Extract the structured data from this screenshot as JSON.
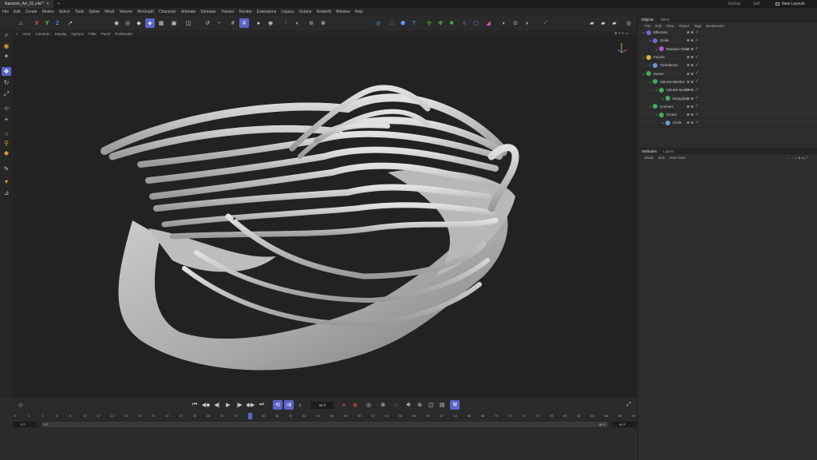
{
  "titlebar": {
    "doc_tab": "Random_Art_01.c4d *",
    "close": "×",
    "new_tab": "+",
    "right_items": [
      "Startup",
      "Sell",
      "New Layouts"
    ]
  },
  "menu": [
    "File",
    "Edit",
    "Create",
    "Modes",
    "Select",
    "Tools",
    "Spline",
    "Mesh",
    "Volume",
    "MoGraph",
    "Character",
    "Animate",
    "Simulate",
    "Tracker",
    "Render",
    "Extensions",
    "Legacy",
    "Octane",
    "Redshift",
    "Window",
    "Help"
  ],
  "axis_lock": {
    "x": "X",
    "y": "Y",
    "z": "Z"
  },
  "viewport_menu": [
    "View",
    "Cameras",
    "Display",
    "Options",
    "Filter",
    "Panel",
    "ProRender"
  ],
  "timeline": {
    "current_frame": "34 F",
    "ruler_ticks": [
      "0",
      "2",
      "4",
      "6",
      "8",
      "10",
      "12",
      "14",
      "16",
      "18",
      "20",
      "22",
      "24",
      "26",
      "28",
      "30",
      "32",
      "34",
      "36",
      "38",
      "40",
      "42",
      "44",
      "46",
      "48",
      "50",
      "52",
      "54",
      "56",
      "58",
      "60",
      "62",
      "64",
      "66",
      "68",
      "70",
      "72",
      "74",
      "76",
      "78",
      "80",
      "82",
      "84",
      "86",
      "88",
      "90"
    ],
    "start": "0 F",
    "range_start": "0 F",
    "range_end": "90 F",
    "end": "90 F",
    "playhead_label": "34",
    "playhead_fraction": 0.378
  },
  "objects_panel": {
    "tabs": [
      "Objects",
      "Takes"
    ],
    "menu": [
      "File",
      "Edit",
      "View",
      "Object",
      "Tags",
      "Bookmarks"
    ],
    "rows": [
      {
        "name": "Effectors",
        "indent": 0,
        "icon_color": "#6a6ad6"
      },
      {
        "name": "Scale",
        "indent": 1,
        "icon_color": "#6a6ad6"
      },
      {
        "name": "Random Field",
        "indent": 2,
        "icon_color": "#b05ad0"
      },
      {
        "name": "Forces",
        "indent": 0,
        "icon_color": "#d9b13a"
      },
      {
        "name": "Turbulence",
        "indent": 1,
        "icon_color": "#6a9ad6"
      },
      {
        "name": "Scene",
        "indent": 0,
        "icon_color": "#3fae5a"
      },
      {
        "name": "Volume Mesher",
        "indent": 1,
        "icon_color": "#3fae5a"
      },
      {
        "name": "Volume Builder",
        "indent": 2,
        "icon_color": "#3fae5a"
      },
      {
        "name": "MoSpline",
        "indent": 3,
        "icon_color": "#3fae5a"
      },
      {
        "name": "Connect",
        "indent": 1,
        "icon_color": "#3fae5a"
      },
      {
        "name": "Cloner",
        "indent": 2,
        "icon_color": "#3fae5a"
      },
      {
        "name": "Circle",
        "indent": 3,
        "icon_color": "#6a9ad6"
      }
    ]
  },
  "attributes_panel": {
    "tabs": [
      "Attributes",
      "Layers"
    ],
    "menu": [
      "Mode",
      "Edit",
      "User Data"
    ]
  },
  "colors": {
    "accent": "#5b63c8",
    "check": "#3fc13f",
    "record": "#c83a3a"
  }
}
